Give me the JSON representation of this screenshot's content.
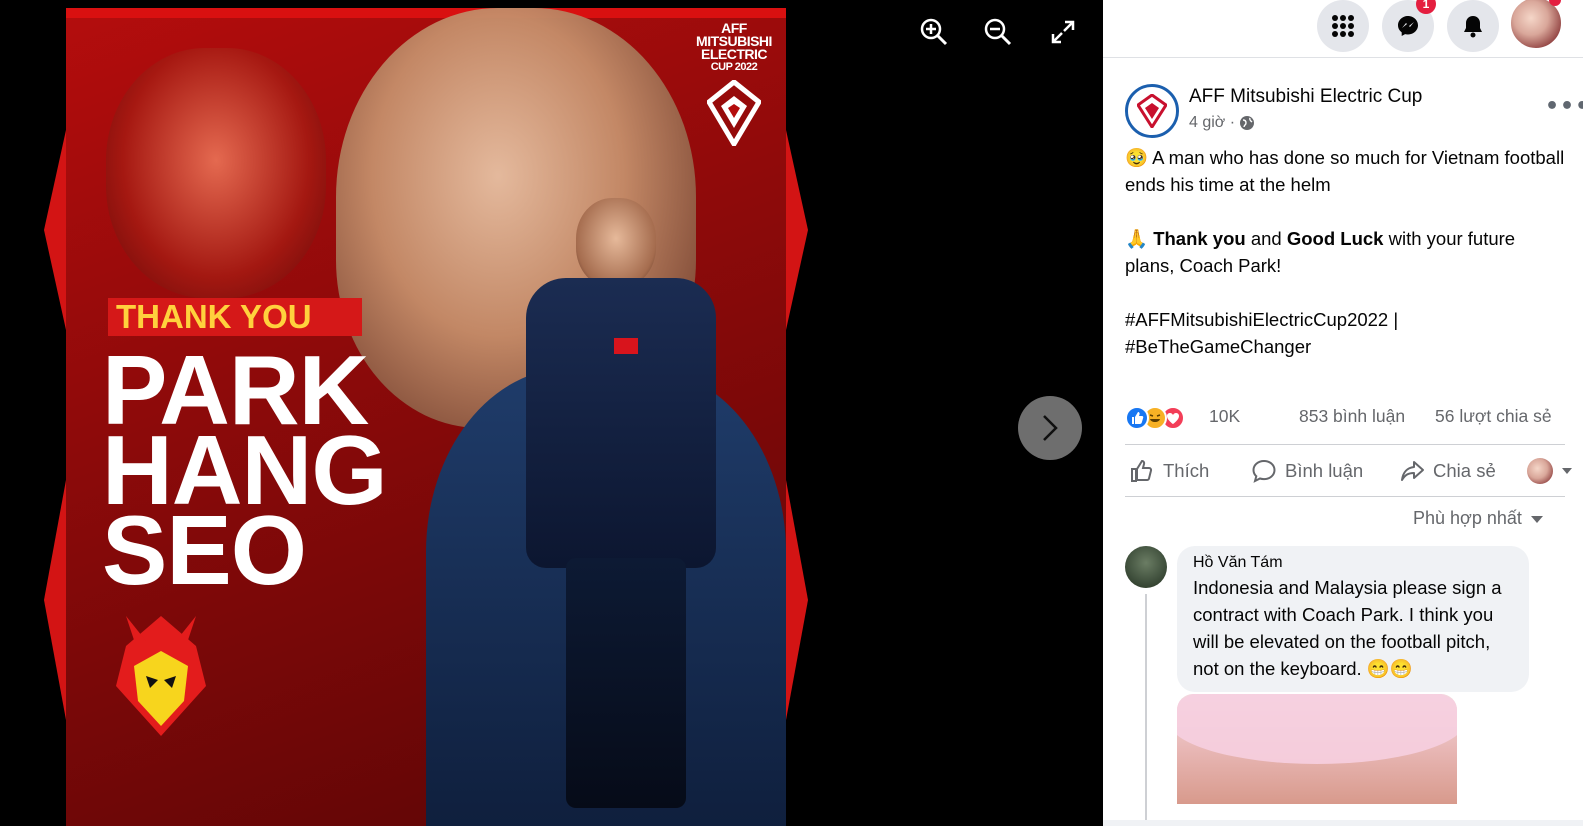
{
  "viewer": {
    "poster": {
      "logo_line1": "AFF",
      "logo_line2": "MITSUBISHI",
      "logo_line3": "ELECTRIC",
      "logo_line4": "CUP 2022",
      "thank_you": "THANK YOU",
      "name_line1": "PARK",
      "name_line2": "HANG",
      "name_line3": "SEO"
    },
    "controls": {
      "zoom_in": "zoom-in-icon",
      "zoom_out": "zoom-out-icon",
      "fullscreen": "fullscreen-icon",
      "next": "chevron-right-icon"
    }
  },
  "topbar": {
    "icons": [
      "apps-grid-icon",
      "messenger-icon",
      "notifications-bell-icon"
    ],
    "messenger_badge": "1"
  },
  "post": {
    "page_name": "AFF Mitsubishi Electric Cup",
    "time": "4 giờ ·",
    "paragraph1": "🥹 A man who has done so much for Vietnam football ends his time at the helm",
    "p2_emoji": "🙏 ",
    "p2_bold1": "Thank you",
    "p2_mid": " and ",
    "p2_bold2": "Good Luck",
    "p2_rest": " with your future plans, Coach Park!",
    "hashtag1": "#AFFMitsubishiElectricCup2022 |",
    "hashtag2": "#BeTheGameChanger"
  },
  "reactions": {
    "count": "10K",
    "comments": "853 bình luận",
    "shares": "56 lượt chia sẻ"
  },
  "actions": {
    "like": "Thích",
    "comment": "Bình luận",
    "share": "Chia sẻ"
  },
  "sort": {
    "label": "Phù hợp nhất"
  },
  "comment": {
    "author": "Hồ Văn Tám",
    "text": "Indonesia and Malaysia please sign a contract with Coach Park. I think you will be elevated on the football pitch, not on the keyboard. 😁😁"
  },
  "colors": {
    "brand_blue": "#1877f2",
    "poster_red": "#b40d0d",
    "thank_you_yellow": "#ffd13d"
  }
}
